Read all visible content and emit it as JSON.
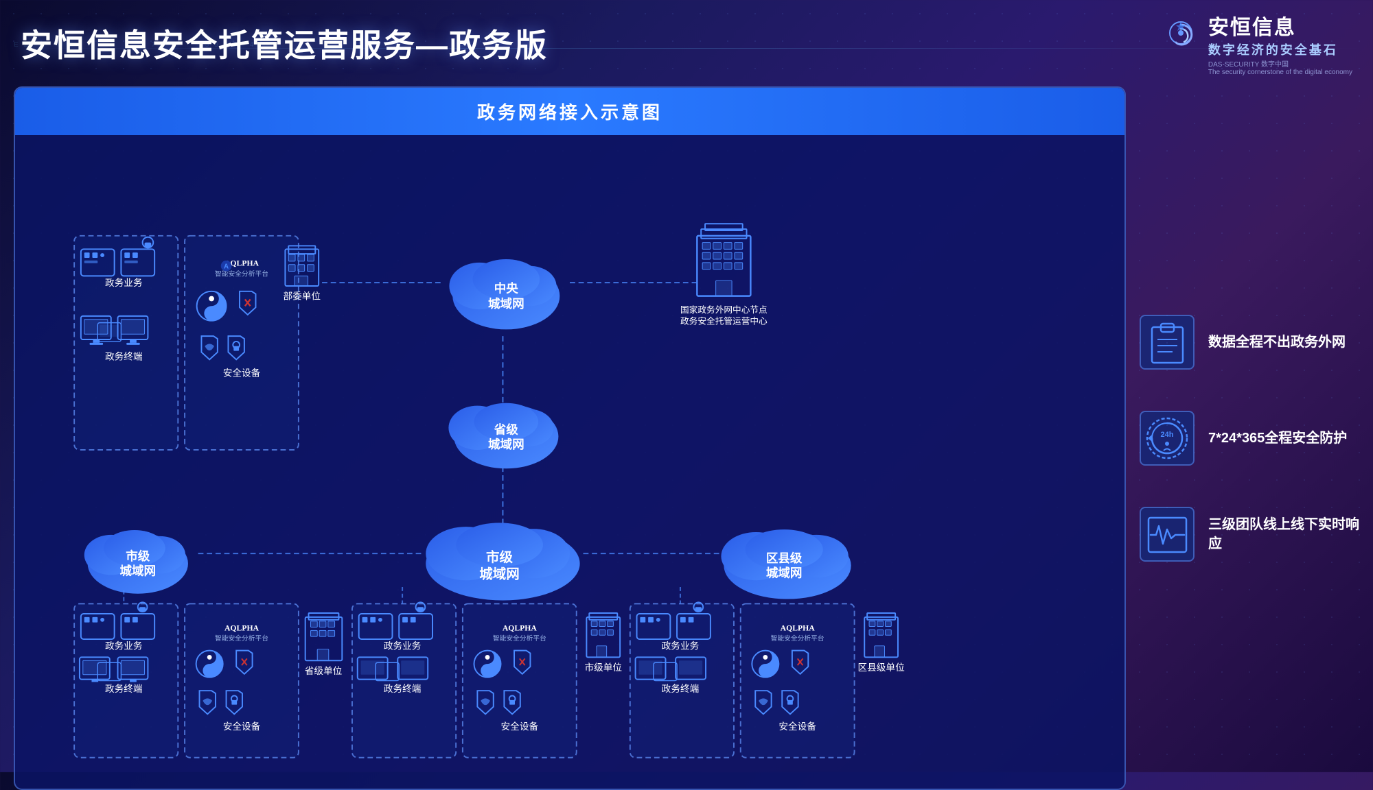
{
  "header": {
    "title": "安恒信息安全托管运营服务—政务版",
    "logo_name": "安恒信息",
    "logo_subtitle1": "DAS-SECURITY 数字中国",
    "logo_subtitle2": "The security cornerstone of the digital economy",
    "logo_tagline": "数字经济的安全基石"
  },
  "diagram": {
    "title": "政务网络接入示意图",
    "nodes": {
      "central_metro": "中央\n城域网",
      "provincial_metro": "省级\n城域网",
      "city_metro_main": "市级\n城域网",
      "city_metro_side": "市级\n城域网",
      "district_metro": "区县级\n城域网",
      "ministry_unit": "部委单位",
      "national_center": "国家政务外网中心节点\n政务安全托管运营中心",
      "provincial_unit": "省级单位",
      "city_unit": "市级单位",
      "district_unit": "区县级单位"
    },
    "device_groups": [
      {
        "id": "top-left",
        "items": [
          "政务业务",
          "政务终端"
        ],
        "security": "安全设备",
        "alpha_label": "AQLPHA\n智能安全分析平台"
      }
    ],
    "features": [
      {
        "id": "data-network",
        "icon": "clipboard",
        "text": "数据全程不出政务外网"
      },
      {
        "id": "24h-protection",
        "icon": "clock24",
        "text": "7*24*365全程安全防护"
      },
      {
        "id": "three-tier",
        "icon": "heartbeat",
        "text": "三级团队线上线下实时响应"
      }
    ]
  }
}
